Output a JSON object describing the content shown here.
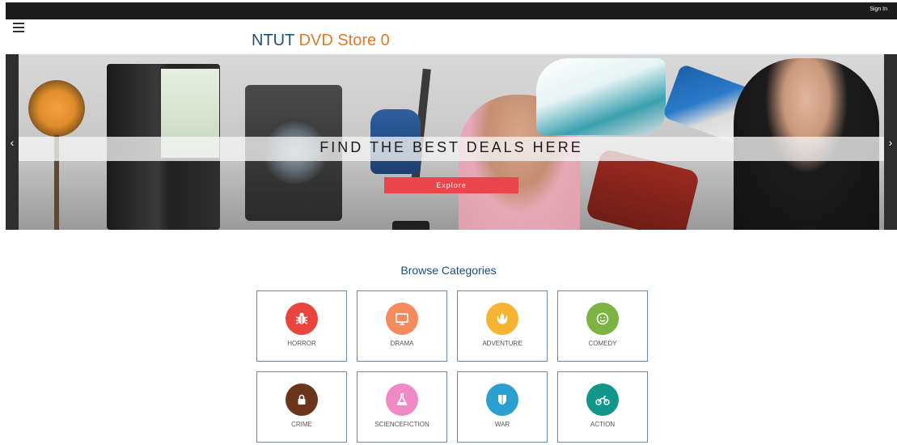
{
  "topbar": {
    "signin_label": "Sign In"
  },
  "header": {
    "brand_part1": "NTUT",
    "brand_part2": "DVD Store 0"
  },
  "hero": {
    "title": "FIND THE BEST DEALS HERE",
    "button_label": "Explore",
    "prev_icon": "chevron-left-icon",
    "next_icon": "chevron-right-icon"
  },
  "categories": {
    "title": "Browse Categories",
    "items": [
      {
        "label": "HORROR",
        "icon": "bug-icon",
        "color": "#e8453c"
      },
      {
        "label": "DRAMA",
        "icon": "monitor-icon",
        "color": "#f58a5c"
      },
      {
        "label": "ADVENTURE",
        "icon": "rebel-icon",
        "color": "#f7b433"
      },
      {
        "label": "COMEDY",
        "icon": "smile-icon",
        "color": "#7cb342"
      },
      {
        "label": "CRIME",
        "icon": "lock-icon",
        "color": "#6b3519"
      },
      {
        "label": "SCIENCEFICTION",
        "icon": "flask-icon",
        "color": "#f08ac6"
      },
      {
        "label": "WAR",
        "icon": "shield-icon",
        "color": "#2a9fd0"
      },
      {
        "label": "ACTION",
        "icon": "motorcycle-icon",
        "color": "#12968a"
      }
    ]
  },
  "colors": {
    "brand_blue": "#1f4e79",
    "brand_orange": "#e07b24",
    "explore_red": "#e9454b"
  }
}
